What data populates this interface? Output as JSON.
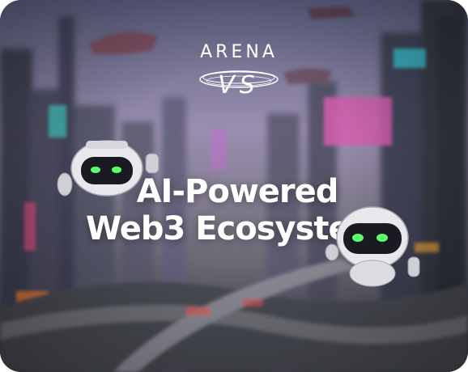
{
  "hero": {
    "logo_text": "ARENA",
    "logo_subtext": "VS",
    "headline_line1": "AI-Powered",
    "headline_line2": "Web3 Ecosystem"
  },
  "icons": {
    "robot_left": "robot-icon",
    "robot_right": "robot-icon"
  },
  "colors": {
    "text": "#ffffff",
    "robot_eye": "#5dff6a",
    "robot_body": "#e8e8ec"
  }
}
